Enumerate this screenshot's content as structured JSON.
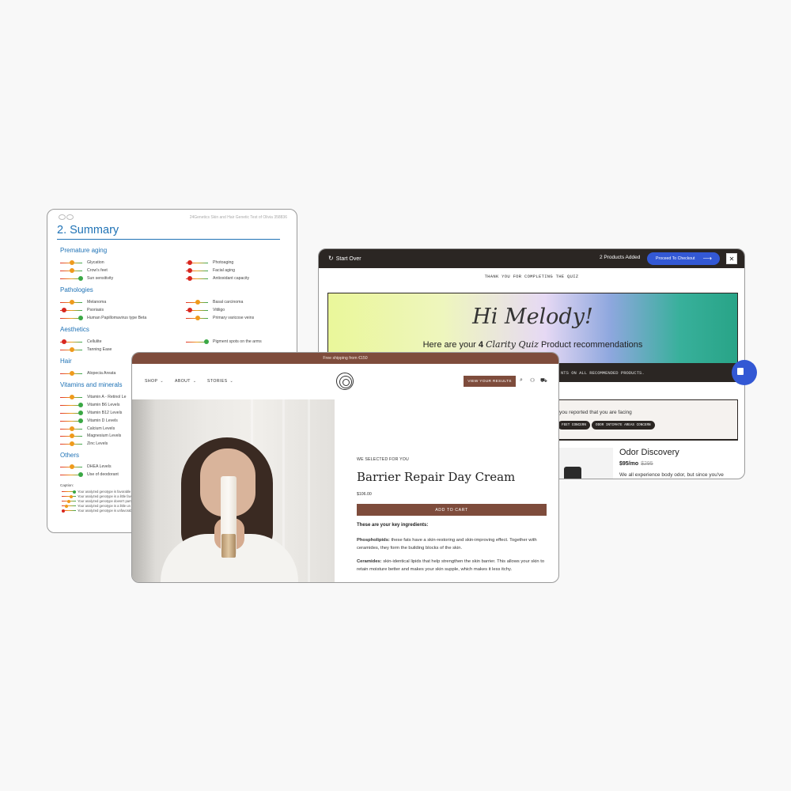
{
  "report": {
    "header_text": "24Genetics Skin and Hair Genetic Test of Olivia 358836",
    "title": "2. Summary",
    "sections": [
      {
        "name": "Premature aging"
      },
      {
        "name": "Pathologies"
      },
      {
        "name": "Aesthetics"
      },
      {
        "name": "Hair"
      },
      {
        "name": "Vitamins and minerals"
      },
      {
        "name": "Others"
      }
    ],
    "items": [
      {
        "label": "Glycation",
        "status": "orange"
      },
      {
        "label": "Crow's feet",
        "status": "orange"
      },
      {
        "label": "Sun sensitivity",
        "status": "green"
      },
      {
        "label": "Photoaging",
        "status": "red"
      },
      {
        "label": "Facial aging",
        "status": "red"
      },
      {
        "label": "Antioxidant capacity",
        "status": "red"
      },
      {
        "label": "Melanoma",
        "status": "orange"
      },
      {
        "label": "Psoriasis",
        "status": "red"
      },
      {
        "label": "Human Papillomavirus type Beta",
        "status": "green"
      },
      {
        "label": "Basal carcinoma",
        "status": "orange"
      },
      {
        "label": "Vitiligo",
        "status": "red"
      },
      {
        "label": "Primary varicose veins",
        "status": "orange"
      },
      {
        "label": "Cellulite",
        "status": "red"
      },
      {
        "label": "Tanning Ease",
        "status": "orange"
      },
      {
        "label": "Pigment spots on the arms",
        "status": "green"
      },
      {
        "label": "Alopecia Areata",
        "status": "orange"
      },
      {
        "label": "Vitamin A - Retinol Le",
        "status": "orange"
      },
      {
        "label": "Vitamin B6 Levels",
        "status": "green"
      },
      {
        "label": "Vitamin B12 Levels",
        "status": "green"
      },
      {
        "label": "Vitamin D Levels",
        "status": "green"
      },
      {
        "label": "Calcium Levels",
        "status": "orange"
      },
      {
        "label": "Magnesium Levels",
        "status": "orange"
      },
      {
        "label": "Zinc Levels",
        "status": "orange"
      },
      {
        "label": "DHEA Levels",
        "status": "orange"
      },
      {
        "label": "Use of deodorant",
        "status": "green"
      }
    ],
    "caption_title": "Caption:",
    "caption_rows": [
      "Your analyzed genotype is favorable",
      "Your analyzed genotype is a little fav",
      "Your analyzed genotype doesn't part",
      "Your analyzed genotype is a little un",
      "Your analyzed genotype is unfavorab"
    ],
    "colors": {
      "red": "#d8261f",
      "orange": "#ef9a1c",
      "green": "#3aa845",
      "accent": "#2073b6"
    }
  },
  "quiz": {
    "start_over": "Start Over",
    "products_added": "2 Products Added",
    "checkout": "Proceed To Checkout",
    "close": "✕",
    "thanks": "THANK YOU FOR COMPLETING THE QUIZ",
    "greeting": "Hi Melody!",
    "rec_prefix": "Here are your",
    "rec_count": "4",
    "rec_quiz": "Clarity Quiz",
    "rec_suffix": "Product recommendations",
    "strip_text": "NTS ON ALL RECOMMENDED PRODUCTS.",
    "facing_text": "you reported that you are facing",
    "chips": [
      "FEET CONCERN",
      "ODOR INTIMATE AREAS CONCERN"
    ],
    "product_name": "Odor Discovery",
    "product_price": "$95/mo",
    "product_old_price": "$295",
    "product_desc": "We all experience body odor, but since you've"
  },
  "shop": {
    "announcement": "Free shipping from €150",
    "nav": [
      {
        "label": "SHOP"
      },
      {
        "label": "ABOUT"
      },
      {
        "label": "STORIES"
      }
    ],
    "view_results": "VIEW YOUR RESULTS",
    "kicker": "WE SELECTED FOR YOU",
    "product_title": "Barrier Repair Day Cream",
    "price": "$106.00",
    "add_to_cart": "ADD TO CART",
    "key_ingredients": "These are your key ingredients:",
    "ing1_name": "Phospholipids:",
    "ing1_text": "these fats have a skin-restoring and skin-improving effect. Together with ceramides, they form the building blocks of the skin.",
    "ing2_name": "Ceramides:",
    "ing2_text": "skin-identical lipids that help strengthen the skin barrier. This allows your skin to retain moisture better and makes your skin supple, which makes it less itchy."
  }
}
